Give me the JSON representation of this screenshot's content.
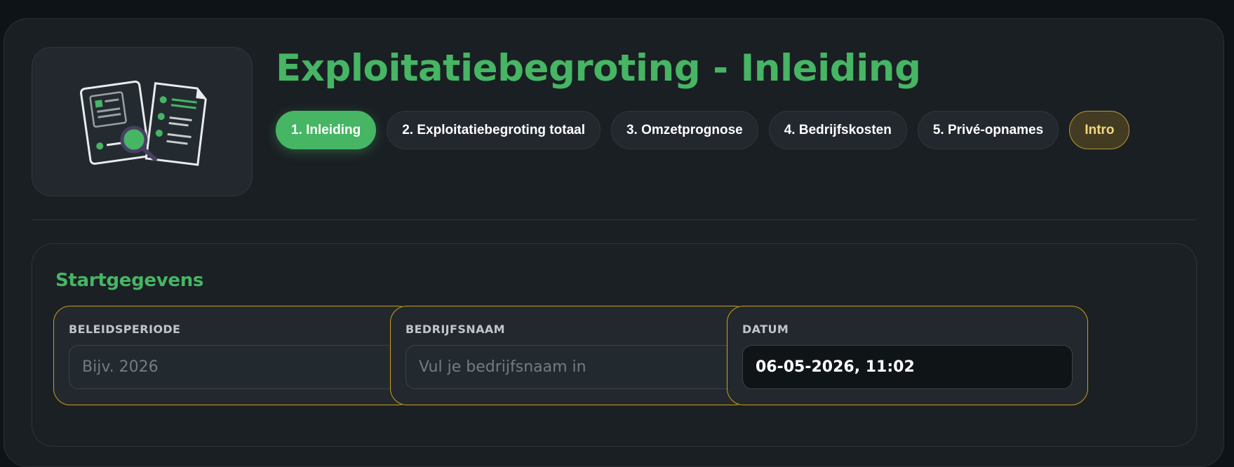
{
  "header": {
    "title": "Exploitatiebegroting - Inleiding",
    "logo_icon": "documents-magnifier-icon"
  },
  "tabs": [
    {
      "label": "1. Inleiding",
      "state": "active"
    },
    {
      "label": "2. Exploitatiebegroting totaal",
      "state": "default"
    },
    {
      "label": "3. Omzetprognose",
      "state": "default"
    },
    {
      "label": "4. Bedrijfskosten",
      "state": "default"
    },
    {
      "label": "5. Privé-opnames",
      "state": "default"
    },
    {
      "label": "Intro",
      "state": "intro"
    }
  ],
  "startgegevens": {
    "title": "Startgegevens",
    "fields": [
      {
        "label": "BELEIDSPERIODE",
        "value": "",
        "placeholder": "Bijv. 2026"
      },
      {
        "label": "BEDRIJFSNAAM",
        "value": "",
        "placeholder": "Vul je bedrijfsnaam in"
      },
      {
        "label": "DATUM",
        "value": "06-05-2026, 11:02",
        "placeholder": ""
      }
    ]
  },
  "colors": {
    "accent_green": "#46b564",
    "field_border_gold": "#caa019",
    "intro_text": "#f2d880",
    "background": "#1a1f23"
  }
}
